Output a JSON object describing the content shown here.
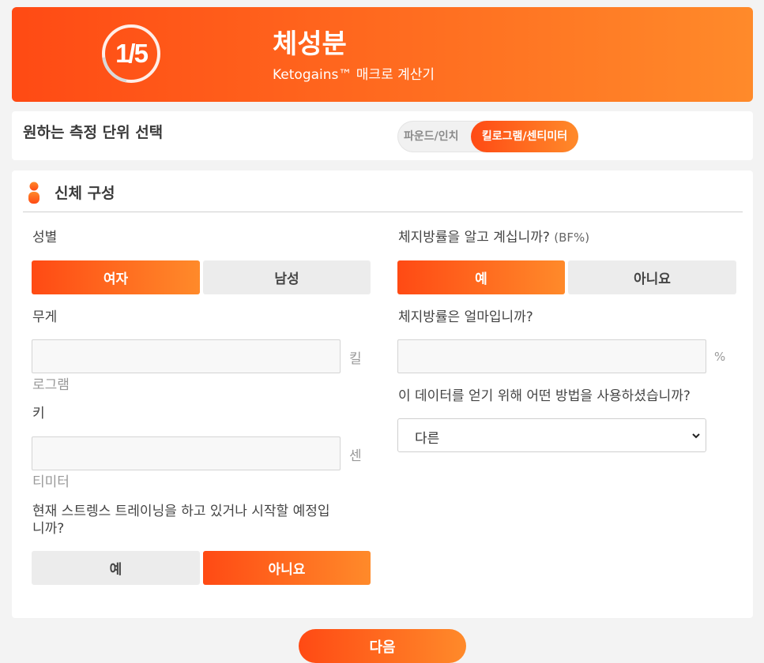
{
  "header": {
    "step": "1/5",
    "step_progress": 0.2,
    "title": "체성분",
    "subtitle": "Ketogains™ 매크로 계산기"
  },
  "units": {
    "label": "원하는 측정 단위 선택",
    "options": [
      "파운드/인치",
      "킬로그램/센티미터"
    ],
    "selected": "킬로그램/센티미터"
  },
  "body_composition": {
    "title": "신체 구성",
    "sex": {
      "label": "성별",
      "options": [
        "여자",
        "남성"
      ],
      "selected": "여자"
    },
    "weight": {
      "label": "무게",
      "value": "",
      "unit_line1": "킬",
      "unit_line2": "로그램"
    },
    "height": {
      "label": "키",
      "value": "",
      "unit_line1": "센",
      "unit_line2": "티미터"
    },
    "strength_training": {
      "label_line1": "현재 스트렝스 트레이닝을 하고 있거나 시작할 예정입",
      "label_line2": "니까?",
      "options": [
        "예",
        "아니요"
      ],
      "selected": "아니요"
    },
    "know_bf": {
      "label": "체지방률을 알고 계십니까?",
      "label_suffix": "(BF%)",
      "options": [
        "예",
        "아니요"
      ],
      "selected": "예"
    },
    "bf_value": {
      "label": "체지방률은 얼마입니까?",
      "value": "",
      "unit": "%"
    },
    "method": {
      "label": "이 데이터를 얻기 위해 어떤 방법을 사용하셨습니까?",
      "selected": "다른"
    }
  },
  "next_label": "다음",
  "colors": {
    "accent_start": "#ff4a14",
    "accent_end": "#ff8a2a",
    "inactive": "#ececec"
  },
  "icons": {
    "person": "person-icon",
    "dropdown": "chevron-down-icon"
  }
}
